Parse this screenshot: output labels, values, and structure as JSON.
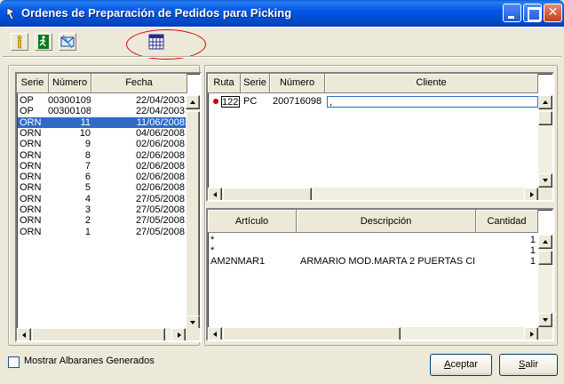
{
  "window": {
    "title": "Ordenes de Preparación de Pedidos para Picking",
    "controls": [
      "minimize",
      "maximize",
      "close"
    ]
  },
  "toolbar": {
    "buttons": [
      {
        "name": "info",
        "icon": "info-icon"
      },
      {
        "name": "exit",
        "icon": "exit-door-icon"
      },
      {
        "name": "mail",
        "icon": "mail-icon"
      },
      {
        "name": "grid",
        "icon": "grid-icon"
      }
    ],
    "highlight_color": "#e00000"
  },
  "series_grid": {
    "columns": [
      "Serie",
      "Número",
      "Fecha"
    ],
    "rows": [
      {
        "serie": "OP",
        "numero": "00300109",
        "fecha": "22/04/2003"
      },
      {
        "serie": "OP",
        "numero": "00300108",
        "fecha": "22/04/2003"
      },
      {
        "serie": "ORN",
        "numero": "11",
        "fecha": "11/06/2008",
        "selected": true
      },
      {
        "serie": "ORN",
        "numero": "10",
        "fecha": "04/06/2008"
      },
      {
        "serie": "ORN",
        "numero": "9",
        "fecha": "02/06/2008"
      },
      {
        "serie": "ORN",
        "numero": "8",
        "fecha": "02/06/2008"
      },
      {
        "serie": "ORN",
        "numero": "7",
        "fecha": "02/06/2008"
      },
      {
        "serie": "ORN",
        "numero": "6",
        "fecha": "02/06/2008"
      },
      {
        "serie": "ORN",
        "numero": "5",
        "fecha": "02/06/2008"
      },
      {
        "serie": "ORN",
        "numero": "4",
        "fecha": "27/05/2008"
      },
      {
        "serie": "ORN",
        "numero": "3",
        "fecha": "27/05/2008"
      },
      {
        "serie": "ORN",
        "numero": "2",
        "fecha": "27/05/2008"
      },
      {
        "serie": "ORN",
        "numero": "1",
        "fecha": "27/05/2008"
      }
    ]
  },
  "routes_grid": {
    "columns": [
      "Ruta",
      "Serie",
      "Número",
      "Cliente"
    ],
    "rows": [
      {
        "ruta": "122",
        "serie": "PC",
        "numero": "200716098",
        "cliente": ","
      }
    ]
  },
  "articles_grid": {
    "columns": [
      "Artículo",
      "Descripción",
      "Cantidad"
    ],
    "rows": [
      {
        "articulo": "*",
        "descripcion": "",
        "cantidad": "1"
      },
      {
        "articulo": "*",
        "descripcion": "",
        "cantidad": "1"
      },
      {
        "articulo": "AM2NMAR1",
        "descripcion": "ARMARIO MOD.MARTA 2 PUERTAS CF",
        "cantidad": "1"
      }
    ]
  },
  "footer": {
    "checkbox_label": "Mostrar Albaranes Generados",
    "checkbox_checked": false,
    "accept_label": "Aceptar",
    "exit_label": "Salir"
  }
}
